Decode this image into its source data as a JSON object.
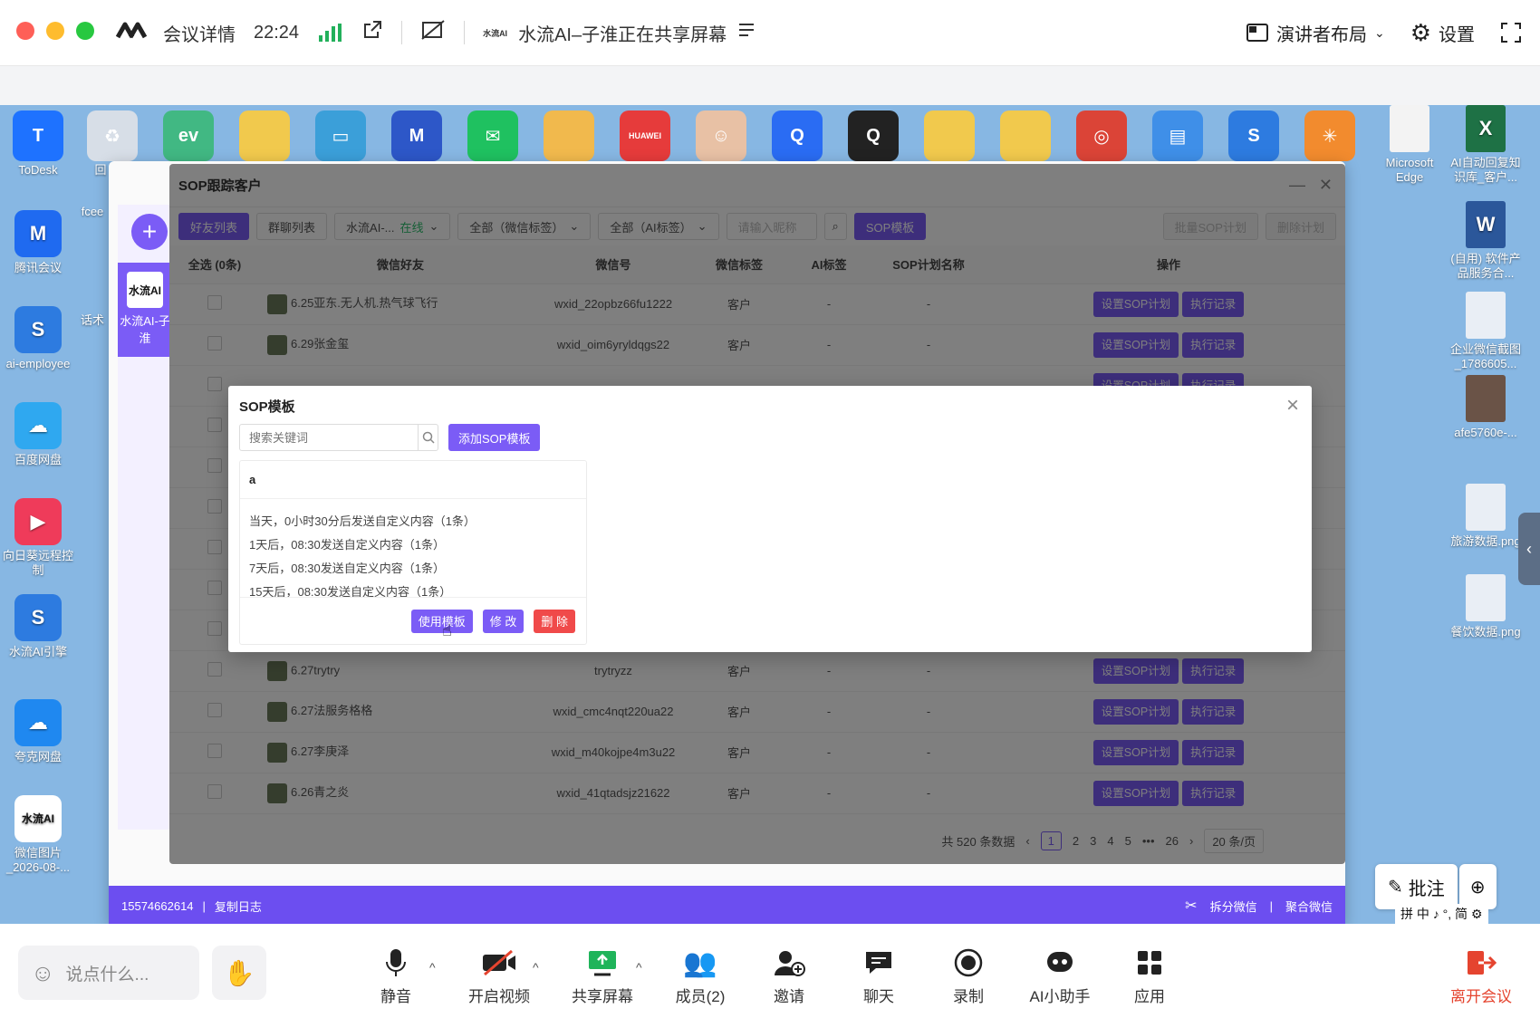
{
  "meeting": {
    "info_label": "会议详情",
    "time": "22:24",
    "sharer_logo": "水流AI",
    "share_status": "水流AI–子淮正在共享屏幕",
    "layout_label": "演讲者布局",
    "settings_label": "设置"
  },
  "desktop": {
    "top_icons": [
      {
        "name": "todesk",
        "label": "ToDesk",
        "color": "#1e72ff",
        "glyph": "T"
      },
      {
        "name": "recycle-bin",
        "label": "回",
        "color": "#d7dee7",
        "glyph": "♻"
      },
      {
        "name": "ev-recorder",
        "label": "",
        "color": "#41b883",
        "glyph": "ev"
      },
      {
        "name": "folder-1",
        "label": "",
        "color": "#f1c94d",
        "glyph": ""
      },
      {
        "name": "monitor",
        "label": "",
        "color": "#3b9fd9",
        "glyph": "▭"
      },
      {
        "name": "m-app",
        "label": "",
        "color": "#2d57c8",
        "glyph": "M"
      },
      {
        "name": "wechat",
        "label": "",
        "color": "#1fc160",
        "glyph": "✉"
      },
      {
        "name": "folder-2",
        "label": "",
        "color": "#f1b94d",
        "glyph": ""
      },
      {
        "name": "huawei",
        "label": "",
        "color": "#e63b3b",
        "glyph": "HUAWEI"
      },
      {
        "name": "avatar-app",
        "label": "",
        "color": "#e8c1a5",
        "glyph": "☺"
      },
      {
        "name": "search-app",
        "label": "",
        "color": "#2a6cf3",
        "glyph": "Q"
      },
      {
        "name": "qq",
        "label": "",
        "color": "#222222",
        "glyph": "Q"
      },
      {
        "name": "folder-3",
        "label": "",
        "color": "#f1c94d",
        "glyph": ""
      },
      {
        "name": "folder-4",
        "label": "",
        "color": "#f1c94d",
        "glyph": ""
      },
      {
        "name": "chrome",
        "label": "",
        "color": "#db4437",
        "glyph": "◎"
      },
      {
        "name": "dashboard",
        "label": "",
        "color": "#3f8fe8",
        "glyph": "▤"
      },
      {
        "name": "swirl-app",
        "label": "",
        "color": "#2d7be0",
        "glyph": "S"
      },
      {
        "name": "star-app",
        "label": "",
        "color": "#f28b2e",
        "glyph": "✳"
      }
    ],
    "left_icons": [
      {
        "name": "tencent-meeting",
        "label": "腾讯会议",
        "color": "#1f6af0",
        "glyph": "M"
      },
      {
        "name": "ai-employee",
        "label": "ai-employee",
        "color": "#2d7be0",
        "glyph": "S"
      },
      {
        "name": "baidu-netdisk",
        "label": "百度网盘",
        "color": "#2fa8f0",
        "glyph": "☁"
      },
      {
        "name": "remote-control",
        "label": "向日葵远程控制",
        "color": "#ef3b5a",
        "glyph": "▶"
      },
      {
        "name": "shuiliu-ai",
        "label": "水流AI引擎",
        "color": "#2d7be0",
        "glyph": "S"
      },
      {
        "name": "quark-netdisk",
        "label": "夸克网盘",
        "color": "#1f88f0",
        "glyph": "☁"
      },
      {
        "name": "wechat-image",
        "label": "微信图片_2026-08-...",
        "color": "#ffffff",
        "glyph": "水流AI"
      }
    ],
    "right_icons": [
      {
        "name": "microsoft-edge",
        "label": "Microsoft Edge",
        "color": "#f3f3f3",
        "glyph": ""
      },
      {
        "name": "excel-file",
        "label": "AI自动回复知识库_客户...",
        "color": "#1e7145",
        "glyph": "X"
      },
      {
        "name": "word-file",
        "label": "(自用) 软件产品服务合...",
        "color": "#2b579a",
        "glyph": "W"
      },
      {
        "name": "wecom-screenshot",
        "label": "企业微信截图_1786605...",
        "color": "#e9eef5",
        "glyph": ""
      },
      {
        "name": "photo-file",
        "label": "afe5760e-...",
        "color": "#6a5347",
        "glyph": ""
      },
      {
        "name": "travel-png",
        "label": "旅游数据.png",
        "color": "#e9eef5",
        "glyph": ""
      },
      {
        "name": "catering-png",
        "label": "餐饮数据.png",
        "color": "#e9eef5",
        "glyph": ""
      }
    ]
  },
  "app": {
    "account_logo": "水流AI",
    "account_name": "水流AI-子淮",
    "phone": "15574662614",
    "copy_log": "复制日志",
    "split_wechat": "拆分微信",
    "merge_wechat": "聚合微信"
  },
  "sop_panel": {
    "title": "SOP跟踪客户",
    "tabs": [
      "好友列表",
      "群聊列表"
    ],
    "account_filter": "水流AI-...",
    "account_status": "在线",
    "wechat_tag_filter": "全部（微信标签）",
    "ai_tag_filter": "全部（AI标签）",
    "nickname_placeholder": "请输入昵称",
    "sop_template_btn": "SOP模板",
    "batch_btn": "批量SOP计划",
    "delete_plan_btn": "删除计划",
    "columns": [
      "全选 (0条)",
      "微信好友",
      "微信号",
      "微信标签",
      "AI标签",
      "SOP计划名称",
      "操作"
    ],
    "rows": [
      {
        "name": "6.25亚东.无人机.热气球飞行",
        "wxid": "wxid_22opbz66fu1222",
        "tag": "客户",
        "ai": "-",
        "plan": "-"
      },
      {
        "name": "6.29张金玺",
        "wxid": "wxid_oim6yryldqgs22",
        "tag": "客户",
        "ai": "-",
        "plan": "-"
      },
      {
        "name": "",
        "wxid": "",
        "tag": "",
        "ai": "",
        "plan": ""
      },
      {
        "name": "",
        "wxid": "",
        "tag": "",
        "ai": "",
        "plan": ""
      },
      {
        "name": "",
        "wxid": "",
        "tag": "",
        "ai": "",
        "plan": ""
      },
      {
        "name": "",
        "wxid": "",
        "tag": "",
        "ai": "",
        "plan": ""
      },
      {
        "name": "",
        "wxid": "",
        "tag": "",
        "ai": "",
        "plan": ""
      },
      {
        "name": "",
        "wxid": "",
        "tag": "",
        "ai": "",
        "plan": ""
      },
      {
        "name": "",
        "wxid": "",
        "tag": "",
        "ai": "",
        "plan": ""
      },
      {
        "name": "6.27trytry",
        "wxid": "trytryzz",
        "tag": "客户",
        "ai": "-",
        "plan": "-"
      },
      {
        "name": "6.27法服务格格",
        "wxid": "wxid_cmc4nqt220ua22",
        "tag": "客户",
        "ai": "-",
        "plan": "-"
      },
      {
        "name": "6.27李庚泽",
        "wxid": "wxid_m40kojpe4m3u22",
        "tag": "客户",
        "ai": "-",
        "plan": "-"
      },
      {
        "name": "6.26青之炎",
        "wxid": "wxid_41qtadsjz21622",
        "tag": "客户",
        "ai": "-",
        "plan": "-"
      }
    ],
    "op_set": "设置SOP计划",
    "op_log": "执行记录",
    "op_log_short": "记录",
    "total": "共 520 条数据",
    "pages": [
      "1",
      "2",
      "3",
      "4",
      "5",
      "•••",
      "26"
    ],
    "page_size": "20 条/页"
  },
  "sop_modal": {
    "title": "SOP模板",
    "search_placeholder": "搜索关键词",
    "add_btn": "添加SOP模板",
    "template": {
      "name": "a",
      "steps": [
        "当天，0小时30分后发送自定义内容（1条）",
        "1天后，08:30发送自定义内容（1条）",
        "7天后，08:30发送自定义内容（1条）",
        "15天后，08:30发送自定义内容（1条）"
      ],
      "use_btn": "使用模板",
      "edit_btn": "修 改",
      "delete_btn": "删 除"
    }
  },
  "annotate": {
    "label": "批注"
  },
  "ime": "拼 中 ♪ °, 简 ⚙",
  "toolbar": {
    "say_placeholder": "说点什么...",
    "mute": "静音",
    "video": "开启视频",
    "share": "共享屏幕",
    "members": "成员(2)",
    "invite": "邀请",
    "chat": "聊天",
    "record": "录制",
    "ai_assistant": "AI小助手",
    "apps": "应用",
    "leave": "离开会议"
  }
}
